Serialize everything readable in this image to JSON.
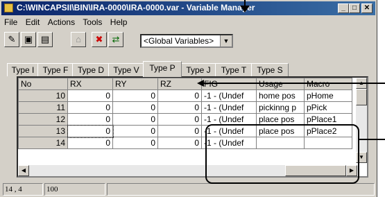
{
  "window": {
    "title": "C:\\WINCAPSII\\BIN\\IRA-0000\\IRA-0000.var - Variable Manager",
    "minimize": "_",
    "maximize": "□",
    "close": "✕"
  },
  "menu": [
    "File",
    "Edit",
    "Actions",
    "Tools",
    "Help"
  ],
  "toolbar": {
    "combo_value": "<Global Variables>",
    "icons": [
      "pen-icon",
      "screen-icon",
      "monitor-icon",
      "trash-icon",
      "red-x-icon",
      "transfer-icon"
    ]
  },
  "tabs": [
    "Type I",
    "Type F",
    "Type D",
    "Type V",
    "Type P",
    "Type J",
    "Type T",
    "Type S"
  ],
  "active_tab": "Type P",
  "grid": {
    "columns": [
      "No",
      "RX",
      "RY",
      "RZ",
      "FIG",
      "Usage",
      "Macro"
    ],
    "rows": [
      [
        "10",
        "0",
        "0",
        "0",
        "-1 - (Undef",
        "home pos",
        "pHome"
      ],
      [
        "11",
        "0",
        "0",
        "0",
        "-1 - (Undef",
        "pickinng p",
        "pPick"
      ],
      [
        "12",
        "0",
        "0",
        "0",
        "-1 - (Undef",
        "place pos",
        "pPlace1"
      ],
      [
        "13",
        "0",
        "0",
        "0",
        "-1 - (Undef",
        "place pos",
        "pPlace2"
      ],
      [
        "14",
        "0",
        "0",
        "0",
        "-1 - (Undef",
        "",
        ""
      ]
    ]
  },
  "status": {
    "position": "14 , 4",
    "zoom": "100"
  }
}
